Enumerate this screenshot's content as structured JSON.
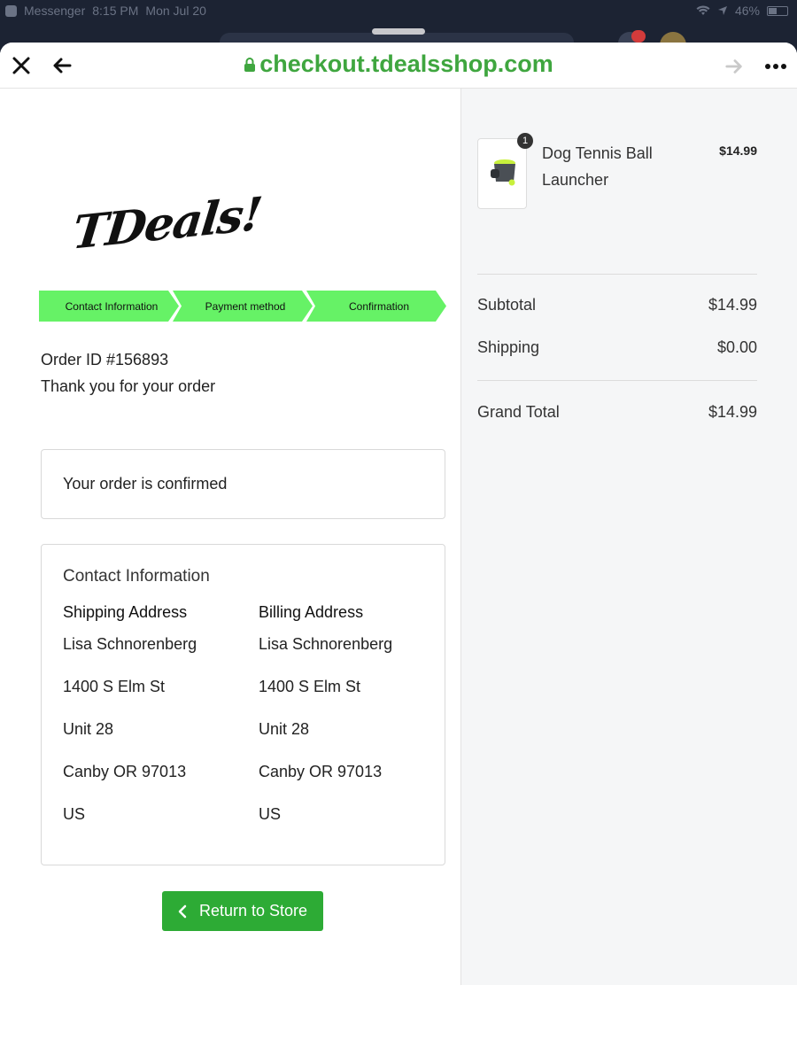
{
  "status_bar": {
    "back_app": "Messenger",
    "time": "8:15 PM",
    "date": "Mon Jul 20",
    "battery": "46%"
  },
  "browser": {
    "url": "checkout.tdealsshop.com"
  },
  "brand": {
    "logo_text": "TDeals!",
    "accent_color": "#3fa63f",
    "step_color": "#66f266",
    "button_color": "#2dab35"
  },
  "steps": [
    {
      "label": "Contact Information"
    },
    {
      "label": "Payment method"
    },
    {
      "label": "Confirmation"
    }
  ],
  "order": {
    "id_text": "Order ID #156893",
    "thanks_text": "Thank you for your order",
    "confirmed_text": "Your order is confirmed"
  },
  "contact": {
    "title": "Contact Information",
    "shipping": {
      "heading": "Shipping Address",
      "name": "Lisa Schnorenberg",
      "street": "1400 S Elm St",
      "unit": "Unit 28",
      "city": "Canby OR 97013",
      "country": "US"
    },
    "billing": {
      "heading": "Billing Address",
      "name": "Lisa Schnorenberg",
      "street": "1400 S Elm St",
      "unit": "Unit 28",
      "city": "Canby OR 97013",
      "country": "US"
    }
  },
  "return_button": {
    "label": "Return to Store"
  },
  "cart": {
    "item": {
      "quantity": "1",
      "name": "Dog Tennis Ball Launcher",
      "price": "$14.99"
    },
    "subtotal_label": "Subtotal",
    "subtotal_value": "$14.99",
    "shipping_label": "Shipping",
    "shipping_value": "$0.00",
    "grand_total_label": "Grand Total",
    "grand_total_value": "$14.99"
  }
}
